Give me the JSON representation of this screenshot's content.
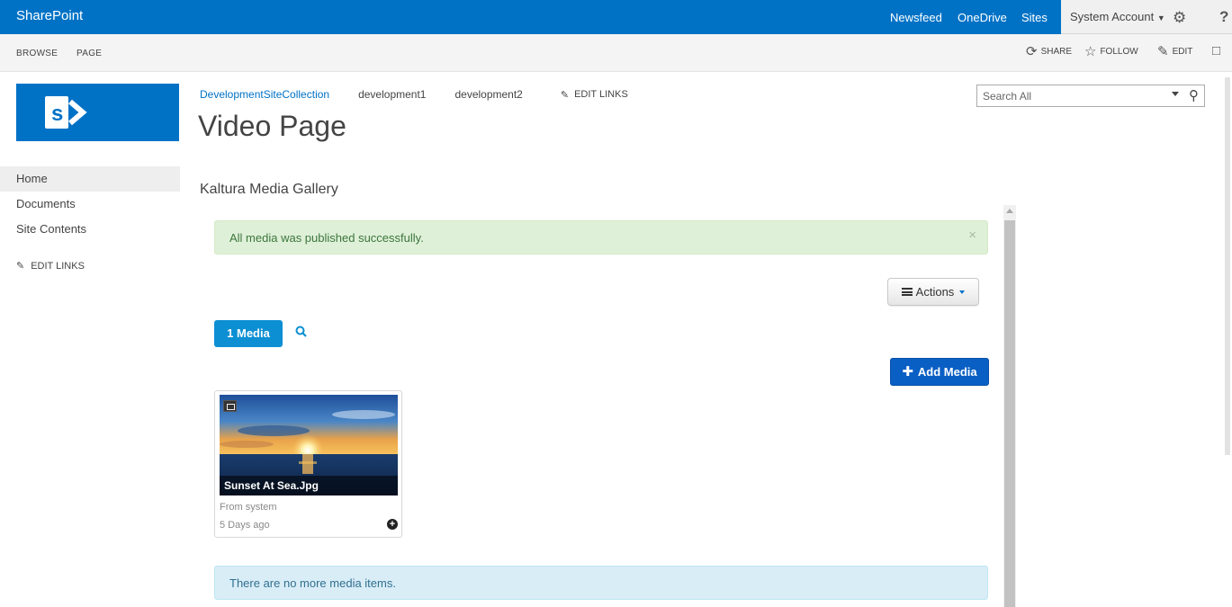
{
  "suitebar": {
    "brand": "SharePoint",
    "links": [
      "Newsfeed",
      "OneDrive",
      "Sites"
    ],
    "account": "System Account",
    "settings_icon": "gear-icon",
    "help_icon": "help-icon",
    "help_glyph": "?"
  },
  "ribbon": {
    "tabs": [
      "BROWSE",
      "PAGE"
    ],
    "share": "SHARE",
    "follow": "FOLLOW",
    "edit": "EDIT"
  },
  "nav": {
    "items": [
      "Home",
      "Documents",
      "Site Contents"
    ],
    "edit_links": "EDIT LINKS"
  },
  "breadcrumbs": {
    "items": [
      "DevelopmentSiteCollection",
      "development1",
      "development2"
    ],
    "edit_links": "EDIT LINKS"
  },
  "page": {
    "title": "Video Page"
  },
  "search": {
    "placeholder": "Search All"
  },
  "gallery": {
    "title": "Kaltura Media Gallery",
    "success_message": "All media was published successfully.",
    "close_glyph": "×",
    "actions_label": "Actions",
    "media_count": "1 Media",
    "add_media_label": "Add Media",
    "info_message": "There are no more media items."
  },
  "media_items": [
    {
      "name": "Sunset At Sea.Jpg",
      "source": "From system",
      "age": "5 Days ago"
    }
  ],
  "colors": {
    "brand": "#0072c6",
    "success_bg": "#dff0d8",
    "info_bg": "#d9edf7",
    "add_button": "#0a5fc4"
  }
}
